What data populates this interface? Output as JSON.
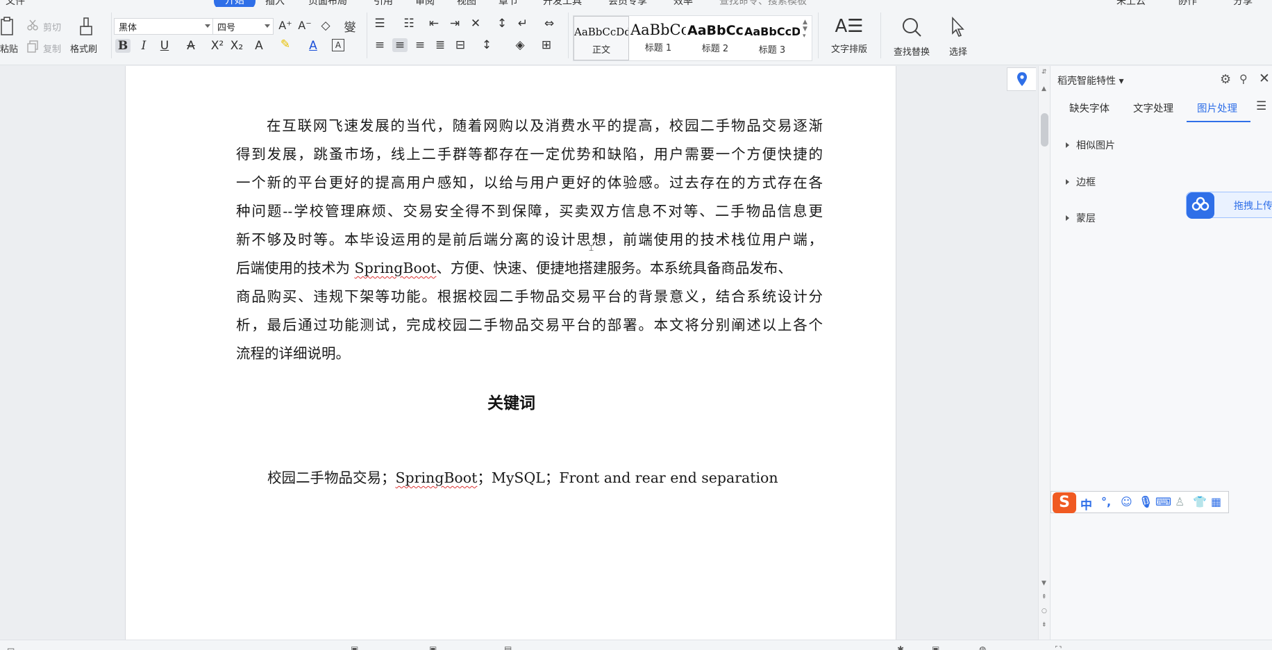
{
  "menu": {
    "items": [
      "文件",
      "开始",
      "插入",
      "页面布局",
      "引用",
      "审阅",
      "视图",
      "章节",
      "开发工具",
      "会员专享",
      "效率"
    ],
    "active": "开始",
    "search_placeholder": "查找命令、搜索模板",
    "right_items": [
      "未上云",
      "协作",
      "分享"
    ]
  },
  "ribbon": {
    "paste_label": "粘贴",
    "cut_label": "剪切",
    "copy_label": "复制",
    "format_painter_label": "格式刷",
    "font_name": "黑体",
    "font_size": "四号",
    "styles": [
      {
        "sample": "AaBbCcDd",
        "label": "正文"
      },
      {
        "sample": "AaBbCc",
        "label": "标题 1"
      },
      {
        "sample": "AaBbCcI",
        "label": "标题 2"
      },
      {
        "sample": "AaBbCcDd",
        "label": "标题 3"
      }
    ],
    "text_layout_label": "文字排版",
    "find_replace_label": "查找替换",
    "select_label": "选择"
  },
  "document": {
    "paragraph_lines": [
      "在互联网飞速发展的当代，随着网购以及消费水平的提高，校园二手物品交易逐渐",
      "得到发展，跳蚤市场，线上二手群等都存在一定优势和缺陷，用户需要一个方便快捷的",
      "一个新的平台更好的提高用户感知，以给与用户更好的体验感。过去存在的方式存在各",
      "种问题--学校管理麻烦、交易安全得不到保障，买卖双方信息不对等、二手物品信息更",
      "新不够及时等。本毕设运用的是前后端分离的设计思想，前端使用的技术栈位用户端，",
      "后端使用的技术为 ",
      "SpringBoot",
      "、方便、快速、便捷地搭建服务。本系统具备商品发布、",
      "商品购买、违规下架等功能。根据校园二手物品交易平台的背景意义，结合系统设计分",
      "析，最后通过功能测试，完成校园二手物品交易平台的部署。本文将分别阐述以上各个",
      "流程的详细说明。"
    ],
    "keywords_heading": "关键词",
    "keywords_prefix": "校园二手物品交易；",
    "keywords_springboot": "SpringBoot",
    "keywords_suffix": "；MySQL；Front and rear end separation"
  },
  "side_panel": {
    "title": "稻壳智能特性",
    "tabs": [
      "缺失字体",
      "文字处理",
      "图片处理"
    ],
    "active_tab": "图片处理",
    "items": [
      "相似图片",
      "边框",
      "蒙层"
    ],
    "cloud_upload_label": "拖拽上传"
  },
  "ime": {
    "logo": "S",
    "mode": "中",
    "punct": "°,"
  },
  "colors": {
    "accent": "#2f6fe8",
    "ime_orange": "#f05a22",
    "spell_underline": "#dd3333"
  }
}
